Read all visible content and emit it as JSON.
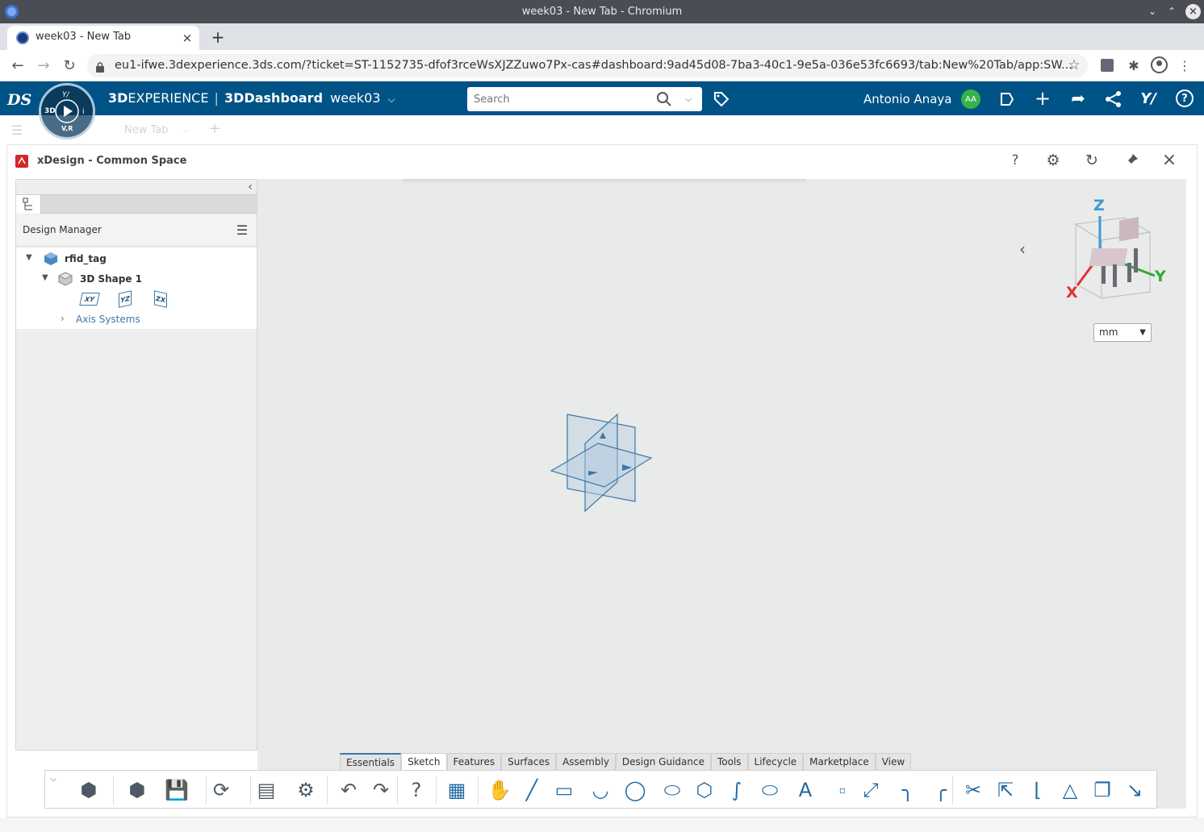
{
  "browser": {
    "window_title": "week03 - New Tab - Chromium",
    "tab_title": "week03 - New Tab",
    "url": "eu1-ifwe.3dexperience.3ds.com/?ticket=ST-1152735-dfof3rceWsXJZZuwo7Px-cas#dashboard:9ad45d08-7ba3-40c1-9e5a-036e53fc6693/tab:New%20Tab/app:SW..."
  },
  "platform": {
    "brand_bold": "3D",
    "brand_rest": "EXPERIENCE",
    "app_name": "3DDashboard",
    "dashboard_name": "week03",
    "search_placeholder": "Search",
    "user_name": "Antonio Anaya",
    "user_initials": "AA",
    "compass_top_text": "3D",
    "compass_bottom_text": "V,R",
    "dashboard_tab": "New Tab",
    "accent": "#005386"
  },
  "widget": {
    "title": "xDesign - Common Space"
  },
  "tree": {
    "panel_title": "Design Manager",
    "root": "rfid_tag",
    "shape": "3D Shape 1",
    "planes": [
      "XY",
      "YZ",
      "ZX"
    ],
    "axis_systems": "Axis Systems"
  },
  "viewport": {
    "units": "mm",
    "compass_axes": {
      "z": "Z",
      "x": "X",
      "y": "Y"
    }
  },
  "action_bar": {
    "tabs": [
      "Essentials",
      "Sketch",
      "Features",
      "Surfaces",
      "Assembly",
      "Design Guidance",
      "Tools",
      "Lifecycle",
      "Marketplace",
      "View"
    ],
    "active_tab": "Sketch",
    "icon_names": [
      "new-shape-icon",
      "part-icon",
      "save-icon",
      "refresh-icon",
      "properties-icon",
      "settings-icon",
      "undo-icon",
      "redo-icon",
      "help-icon",
      "sketch-grid-icon",
      "select-icon",
      "line-icon",
      "rectangle-icon",
      "arc-icon",
      "circle-icon",
      "spline-closed-icon",
      "polygon-icon",
      "spline-icon",
      "slot-icon",
      "text-icon",
      "point-icon",
      "construction-icon",
      "corner-icon",
      "chamfer-icon",
      "trim-icon",
      "project-icon",
      "offset-icon",
      "constraint-icon",
      "3d-view-icon",
      "exit-sketch-icon"
    ]
  }
}
